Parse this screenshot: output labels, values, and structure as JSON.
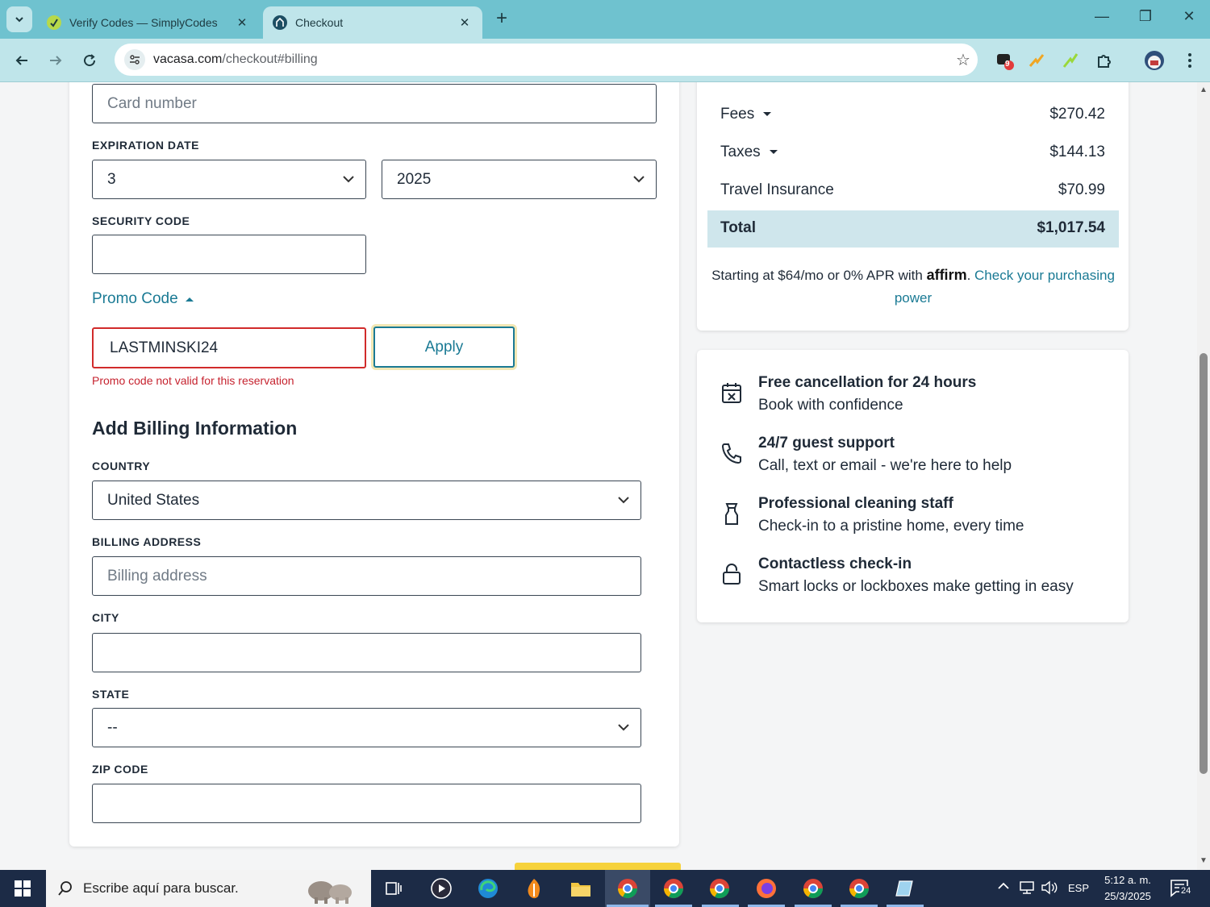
{
  "browser": {
    "tabs": [
      {
        "title": "Verify Codes — SimplyCodes",
        "close": "✕"
      },
      {
        "title": "Checkout",
        "close": "✕"
      }
    ],
    "new_tab": "+",
    "window_controls": {
      "minimize": "—",
      "restore": "❐",
      "close": "✕"
    },
    "url_domain": "vacasa.com",
    "url_path": "/checkout#billing",
    "extension_badge": "9"
  },
  "form": {
    "card_number_placeholder": "Card number",
    "expiration_label": "EXPIRATION DATE",
    "exp_month": "3",
    "exp_year": "2025",
    "security_label": "SECURITY CODE",
    "promo_toggle": "Promo Code",
    "promo_value": "LASTMINSKI24",
    "apply_label": "Apply",
    "promo_error": "Promo code not valid for this reservation",
    "billing_title": "Add Billing Information",
    "country_label": "COUNTRY",
    "country_value": "United States",
    "address_label": "BILLING ADDRESS",
    "address_placeholder": "Billing address",
    "city_label": "CITY",
    "state_label": "STATE",
    "state_value": "--",
    "zip_label": "ZIP CODE"
  },
  "summary": {
    "fees_label": "Fees",
    "fees_value": "$270.42",
    "taxes_label": "Taxes",
    "taxes_value": "$144.13",
    "insurance_label": "Travel Insurance",
    "insurance_value": "$70.99",
    "total_label": "Total",
    "total_value": "$1,017.54",
    "affirm_text": "Starting at $64/mo or 0% APR with",
    "affirm_logo": "affirm",
    "affirm_link": "Check your purchasing power"
  },
  "perks": [
    {
      "title": "Free cancellation for 24 hours",
      "desc": "Book with confidence",
      "icon": "calendar-x-icon"
    },
    {
      "title": "24/7 guest support",
      "desc": "Call, text or email - we're here to help",
      "icon": "phone-icon"
    },
    {
      "title": "Professional cleaning staff",
      "desc": "Check-in to a pristine home, every time",
      "icon": "spray-bottle-icon"
    },
    {
      "title": "Contactless check-in",
      "desc": "Smart locks or lockboxes make getting in easy",
      "icon": "lock-icon"
    }
  ],
  "taskbar": {
    "search_placeholder": "Escribe aquí para buscar.",
    "lang": "ESP",
    "time": "5:12 a. m.",
    "date": "25/3/2025",
    "notification_count": "24"
  },
  "colors": {
    "tabbar": "#6fc2cf",
    "toolbar": "#bfe5ea",
    "accent": "#1a7a94",
    "error": "#d12b2b",
    "total_bg": "#cfe6ec",
    "taskbar": "#1c2b46"
  }
}
